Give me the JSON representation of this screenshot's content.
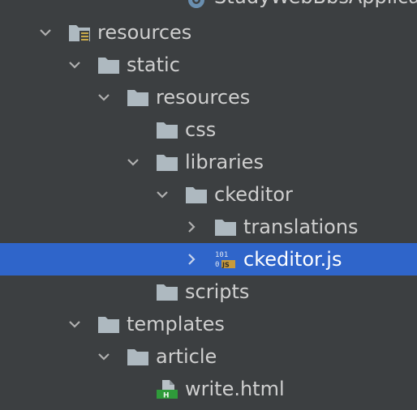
{
  "tree": {
    "items": [
      {
        "label": "StudyWebBbsApplica",
        "icon": "spring-app-icon",
        "expanded": null,
        "selected": false
      },
      {
        "label": "resources",
        "icon": "resources-folder-icon",
        "expanded": true,
        "selected": false
      },
      {
        "label": "static",
        "icon": "folder-icon",
        "expanded": true,
        "selected": false
      },
      {
        "label": "resources",
        "icon": "folder-icon",
        "expanded": true,
        "selected": false
      },
      {
        "label": "css",
        "icon": "folder-icon",
        "expanded": null,
        "selected": false
      },
      {
        "label": "libraries",
        "icon": "folder-icon",
        "expanded": true,
        "selected": false
      },
      {
        "label": "ckeditor",
        "icon": "folder-icon",
        "expanded": true,
        "selected": false
      },
      {
        "label": "translations",
        "icon": "folder-icon",
        "expanded": false,
        "selected": false
      },
      {
        "label": "ckeditor.js",
        "icon": "js-file-icon",
        "expanded": false,
        "selected": true
      },
      {
        "label": "scripts",
        "icon": "folder-icon",
        "expanded": null,
        "selected": false
      },
      {
        "label": "templates",
        "icon": "folder-icon",
        "expanded": true,
        "selected": false
      },
      {
        "label": "article",
        "icon": "folder-icon",
        "expanded": true,
        "selected": false
      },
      {
        "label": "write.html",
        "icon": "html-file-icon",
        "expanded": null,
        "selected": false
      }
    ],
    "colors": {
      "background": "#3c3f41",
      "selection": "#2f65ca",
      "text": "#cfcfcf",
      "folder": "#aeb9c0",
      "html_green": "#2f9b3a",
      "js_orange": "#c89a3a"
    }
  }
}
